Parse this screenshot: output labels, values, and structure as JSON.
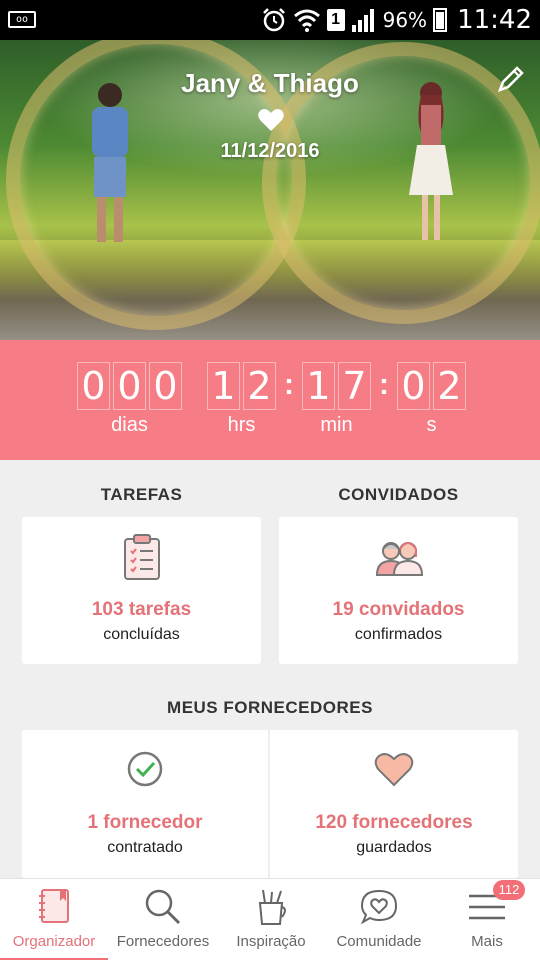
{
  "status_bar": {
    "voicemail": "oo",
    "sim": "1",
    "battery": "96%",
    "time": "11:42"
  },
  "hero": {
    "names": "Jany & Thiago",
    "date": "11/12/2016",
    "edit_icon": "pencil-icon",
    "heart_icon": "heart-icon"
  },
  "countdown": {
    "days": [
      "0",
      "0",
      "0"
    ],
    "hours": [
      "1",
      "2"
    ],
    "minutes": [
      "1",
      "7"
    ],
    "seconds": [
      "0",
      "2"
    ],
    "separator": ":",
    "labels": {
      "days": "dias",
      "hours": "hrs",
      "minutes": "min",
      "seconds": "s"
    }
  },
  "tasks": {
    "title": "TAREFAS",
    "value": "103 tarefas",
    "caption": "concluídas",
    "icon": "clipboard-checklist-icon"
  },
  "guests": {
    "title": "CONVIDADOS",
    "value": "19 convidados",
    "caption": "confirmados",
    "icon": "guests-icon"
  },
  "vendors": {
    "title": "MEUS FORNECEDORES",
    "hired": {
      "value": "1 fornecedor",
      "caption": "contratado",
      "icon": "check-circle-icon"
    },
    "saved": {
      "value": "120 fornecedores",
      "caption": "guardados",
      "icon": "heart-icon"
    }
  },
  "nav": {
    "items": [
      {
        "label": "Organizador",
        "icon": "notebook-icon",
        "active": true
      },
      {
        "label": "Fornecedores",
        "icon": "search-icon"
      },
      {
        "label": "Inspiração",
        "icon": "pencil-cup-icon"
      },
      {
        "label": "Comunidade",
        "icon": "chat-heart-icon"
      },
      {
        "label": "Mais",
        "icon": "menu-icon"
      }
    ],
    "badge": "112"
  },
  "colors": {
    "accent": "#f67d85",
    "accent_text": "#e47277",
    "background": "#efefef"
  }
}
